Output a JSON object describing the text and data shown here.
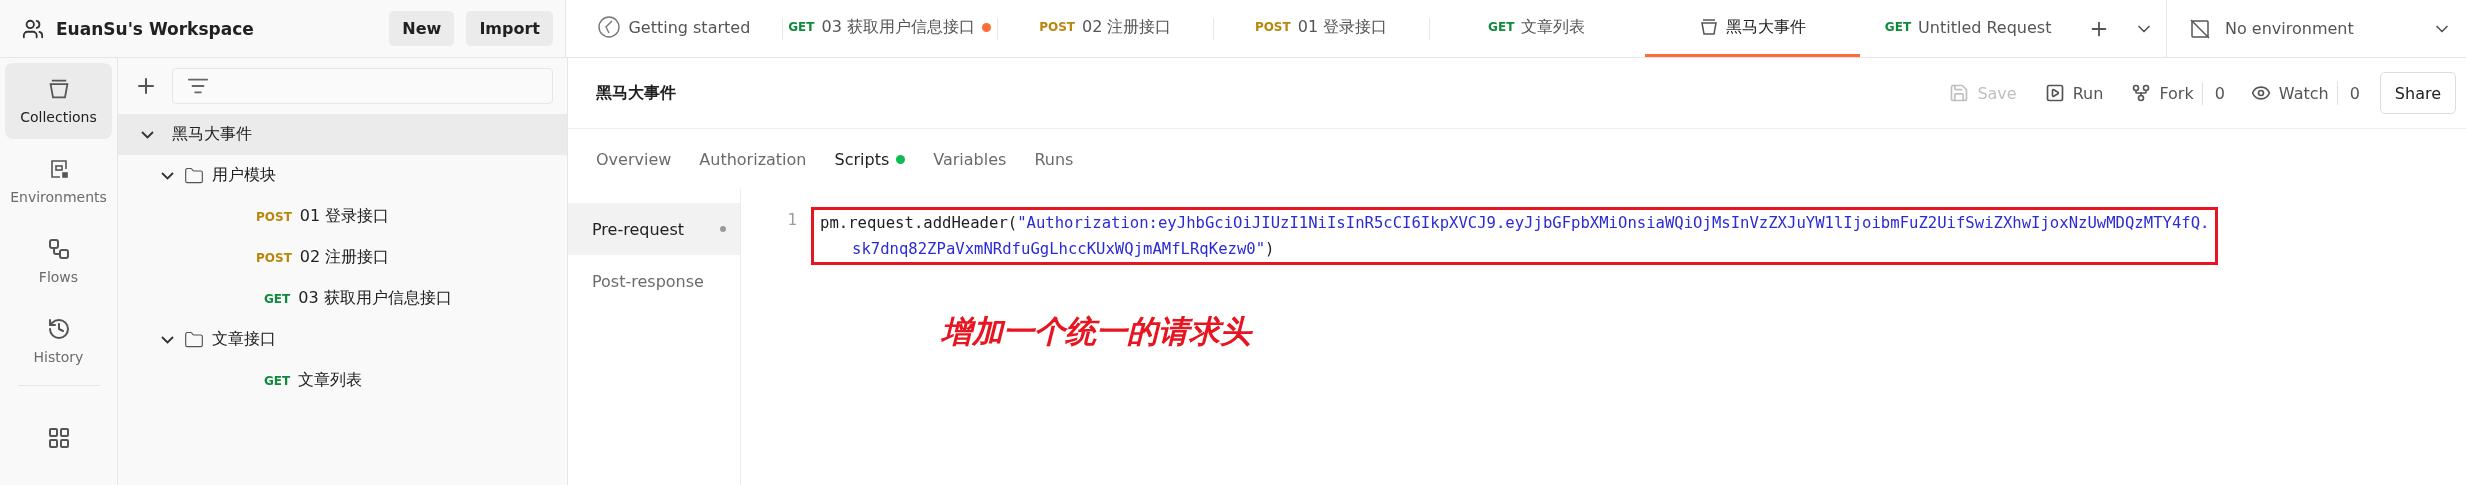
{
  "workspace": {
    "name": "EuanSu's Workspace",
    "buttons": [
      "New",
      "Import"
    ]
  },
  "tabs": [
    {
      "kind": "page",
      "label": "Getting started",
      "selected": false,
      "modified": false
    },
    {
      "kind": "request",
      "method": "GET",
      "label": "03 获取用户信息接口",
      "selected": false,
      "modified": true
    },
    {
      "kind": "request",
      "method": "POST",
      "label": "02 注册接口",
      "selected": false,
      "modified": false
    },
    {
      "kind": "request",
      "method": "POST",
      "label": "01 登录接口",
      "selected": false,
      "modified": false
    },
    {
      "kind": "request",
      "method": "GET",
      "label": "文章列表",
      "selected": false,
      "modified": false
    },
    {
      "kind": "collection",
      "label": "黑马大事件",
      "selected": true,
      "modified": false
    },
    {
      "kind": "request",
      "method": "GET",
      "label": "Untitled Request",
      "selected": false,
      "modified": false
    }
  ],
  "environment": "No environment",
  "nav": [
    {
      "kind": "collections",
      "label": "Collections",
      "selected": true
    },
    {
      "kind": "environments",
      "label": "Environments",
      "selected": false
    },
    {
      "kind": "flows",
      "label": "Flows",
      "selected": false
    },
    {
      "kind": "history",
      "label": "History",
      "selected": false
    },
    {
      "kind": "apps",
      "selected": false
    }
  ],
  "tree": [
    {
      "kind": "collection",
      "label": "黑马大事件",
      "expanded": true,
      "selected": true,
      "children": [
        {
          "kind": "folder",
          "label": "用户模块",
          "expanded": true,
          "selected": false,
          "children": [
            {
              "kind": "request",
              "method": "POST",
              "label": "01 登录接口",
              "selected": false
            },
            {
              "kind": "request",
              "method": "POST",
              "label": "02 注册接口",
              "selected": false
            },
            {
              "kind": "request",
              "method": "GET",
              "label": "03 获取用户信息接口",
              "selected": false
            }
          ]
        },
        {
          "kind": "folder",
          "label": "文章接口",
          "expanded": true,
          "selected": false,
          "children": [
            {
              "kind": "request",
              "method": "GET",
              "label": "文章列表",
              "selected": false
            }
          ]
        }
      ]
    }
  ],
  "header": {
    "title": "黑马大事件",
    "actions": [
      {
        "kind": "save",
        "label": "Save",
        "disabled": true
      },
      {
        "kind": "run",
        "label": "Run"
      },
      {
        "kind": "fork",
        "label": "Fork",
        "count": "0"
      },
      {
        "kind": "watch",
        "label": "Watch",
        "count": "0"
      },
      {
        "kind": "share",
        "label": "Share"
      }
    ]
  },
  "subtabs": [
    {
      "label": "Overview",
      "selected": false,
      "has_content": false
    },
    {
      "label": "Authorization",
      "selected": false,
      "has_content": false
    },
    {
      "label": "Scripts",
      "selected": true,
      "has_content": true
    },
    {
      "label": "Variables",
      "selected": false,
      "has_content": false
    },
    {
      "label": "Runs",
      "selected": false,
      "has_content": false
    }
  ],
  "script_tabs": [
    {
      "label": "Pre-request",
      "selected": true,
      "has_content": true
    },
    {
      "label": "Post-response",
      "selected": false,
      "has_content": false
    }
  ],
  "code": {
    "line_number": "1",
    "call": "pm.request.addHeader(",
    "string_lines": [
      "\"Authorization:eyJhbGciOiJIUzI1NiIsInR5cCI6IkpXVCJ9.eyJjbGFpbXMiOnsiaWQiOjMsInVzZXJuYW1lIjoibmFuZ2UifSwiZXhwIjoxNzUwMDQzMTY4fQ.",
      "sk7dnq82ZPaVxmNRdfuGgLhccKUxWQjmAMfLRqKezw0\""
    ],
    "close": ")",
    "highlighted": true
  },
  "annotation": "增加一个统一的请求头"
}
